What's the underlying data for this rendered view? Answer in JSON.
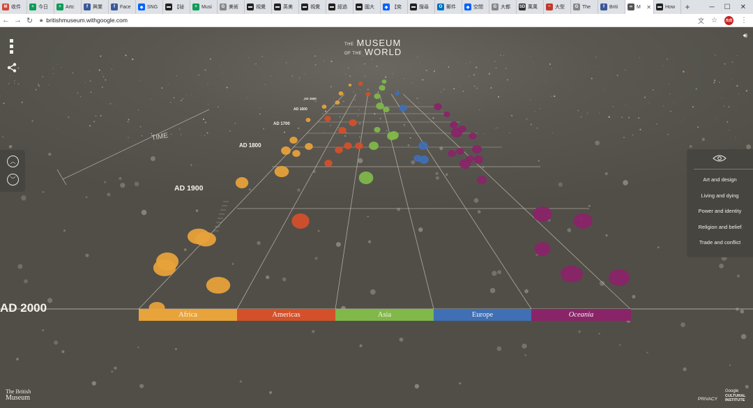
{
  "browser": {
    "tabs": [
      {
        "label": "收件",
        "icon": "gmail-icon",
        "color": "#d44638",
        "glyph": "M"
      },
      {
        "label": "今日",
        "icon": "sheet-icon",
        "color": "#0f9d58",
        "glyph": "+"
      },
      {
        "label": "Artc",
        "icon": "sheet-icon",
        "color": "#0f9d58",
        "glyph": "+"
      },
      {
        "label": "興業",
        "icon": "facebook-icon",
        "color": "#3b5998",
        "glyph": "f"
      },
      {
        "label": "Face",
        "icon": "facebook-icon",
        "color": "#3b5998",
        "glyph": "f"
      },
      {
        "label": "SNG",
        "icon": "dropbox-icon",
        "color": "#0061ff",
        "glyph": "◆"
      },
      {
        "label": "【祕",
        "icon": "page-icon",
        "color": "#222222",
        "glyph": "▬"
      },
      {
        "label": "Musi",
        "icon": "sheet-icon",
        "color": "#0f9d58",
        "glyph": "+"
      },
      {
        "label": "美術",
        "icon": "google-icon",
        "color": "#888888",
        "glyph": "G"
      },
      {
        "label": "視覺",
        "icon": "page-icon",
        "color": "#222222",
        "glyph": "▬"
      },
      {
        "label": "英美",
        "icon": "page-icon",
        "color": "#222222",
        "glyph": "▬"
      },
      {
        "label": "視覺",
        "icon": "page-icon",
        "color": "#222222",
        "glyph": "▬"
      },
      {
        "label": "經過",
        "icon": "page-icon",
        "color": "#222222",
        "glyph": "▬"
      },
      {
        "label": "國大",
        "icon": "page-icon",
        "color": "#222222",
        "glyph": "▬"
      },
      {
        "label": "【奕",
        "icon": "dropbox-icon",
        "color": "#0061ff",
        "glyph": "◆"
      },
      {
        "label": "搜尋",
        "icon": "page-icon",
        "color": "#222222",
        "glyph": "▬"
      },
      {
        "label": "郵件",
        "icon": "outlook-icon",
        "color": "#0072c6",
        "glyph": "O"
      },
      {
        "label": "空間",
        "icon": "dropbox-icon",
        "color": "#0061ff",
        "glyph": "◆"
      },
      {
        "label": "大都",
        "icon": "google-icon",
        "color": "#888888",
        "glyph": "G"
      },
      {
        "label": "萬萬",
        "icon": "sd-icon",
        "color": "#333333",
        "glyph": "SD"
      },
      {
        "label": "大型",
        "icon": "flag-icon",
        "color": "#c0392b",
        "glyph": "~"
      },
      {
        "label": "The",
        "icon": "google-icon",
        "color": "#888888",
        "glyph": "G"
      },
      {
        "label": "Briti",
        "icon": "facebook-icon",
        "color": "#3b5998",
        "glyph": "f"
      },
      {
        "label": "M",
        "icon": "arts-culture-icon",
        "color": "#555555",
        "glyph": "∞",
        "active": true
      },
      {
        "label": "How",
        "icon": "page-icon",
        "color": "#222222",
        "glyph": "▬"
      }
    ],
    "url": "britishmuseum.withgoogle.com",
    "profile_label": "典藏"
  },
  "app": {
    "logo": {
      "line1_small": "THE",
      "line1_big": "MUSEUM",
      "line2_small": "OF THE",
      "line2_big": "WORLD"
    },
    "era_label": "AD 2000",
    "time_word": "TIME",
    "ticks": [
      {
        "label": "AD 1900"
      },
      {
        "label": "AD 1800"
      },
      {
        "label": "AD 1700"
      },
      {
        "label": "AD 1600"
      },
      {
        "label": "AD 1500"
      }
    ],
    "regions": [
      {
        "label": "Africa",
        "color": "#e8a33a",
        "italic": false
      },
      {
        "label": "Americas",
        "color": "#d4502a",
        "italic": false
      },
      {
        "label": "Asia",
        "color": "#80b84a",
        "italic": false
      },
      {
        "label": "Europe",
        "color": "#3f6fb5",
        "italic": false
      },
      {
        "label": "Oceania",
        "color": "#8a2468",
        "italic": true
      }
    ],
    "filters": [
      "Art and design",
      "Living and dying",
      "Power and identity",
      "Religion and belief",
      "Trade and conflict"
    ],
    "footer": {
      "bm_line1": "The British",
      "bm_line2": "Museum",
      "privacy": "PRIVACY",
      "partner_line1": "Google",
      "partner_line2": "CULTURAL",
      "partner_line3": "INSTITUTE"
    }
  }
}
